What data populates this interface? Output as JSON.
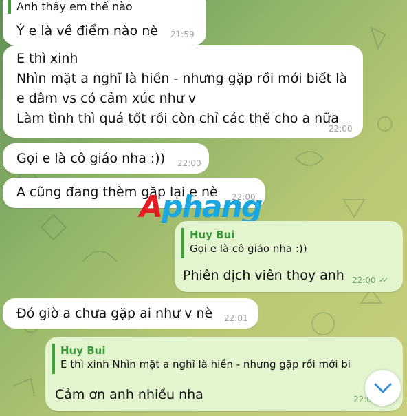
{
  "messages": {
    "m0_reply_partial": "Anh thấy em thế nào",
    "m1_text": "Ý e là về điểm nào nè",
    "m1_time": "21:59",
    "m2_line1": "E thì xinh",
    "m2_line2": "Nhìn mặt a nghĩ là hiền - nhưng gặp rồi mới biết là",
    "m2_line3": "e dâm vs có cảm xúc như v",
    "m2_line4": "Làm tình thì quá tốt rồi còn chỉ các thế cho a nữa",
    "m2_time": "22:00",
    "m3_text": "Gọi e là cô giáo nha :))",
    "m3_time": "22:00",
    "m4_text": "A cũng đang thèm gặp lại e nè",
    "m4_time": "22:00",
    "m5_reply_name": "Huy Bui",
    "m5_reply_text": "Gọi e là cô giáo nha :))",
    "m5_text": "Phiên dịch viên thoy anh",
    "m5_time": "22:00",
    "m5_ticks": "✓✓",
    "m6_text": "Đó giờ a chưa gặp ai như v nè",
    "m6_time": "22:01",
    "m7_reply_name": "Huy Bui",
    "m7_reply_text": "E thì xinh Nhìn mặt a nghĩ là hiền - nhưng gặp rồi mới bi",
    "m7_text": "Cảm ơn anh nhiều nha",
    "m7_time": "22:0"
  },
  "watermark": {
    "part1": "A",
    "part2": "phang"
  },
  "icons": {
    "scroll_down": "chevron-down-icon"
  },
  "colors": {
    "incoming_bubble": "#ffffff",
    "outgoing_bubble": "#e3f5cf",
    "reply_accent": "#3fa33a",
    "timestamp": "#9aa0a6"
  }
}
